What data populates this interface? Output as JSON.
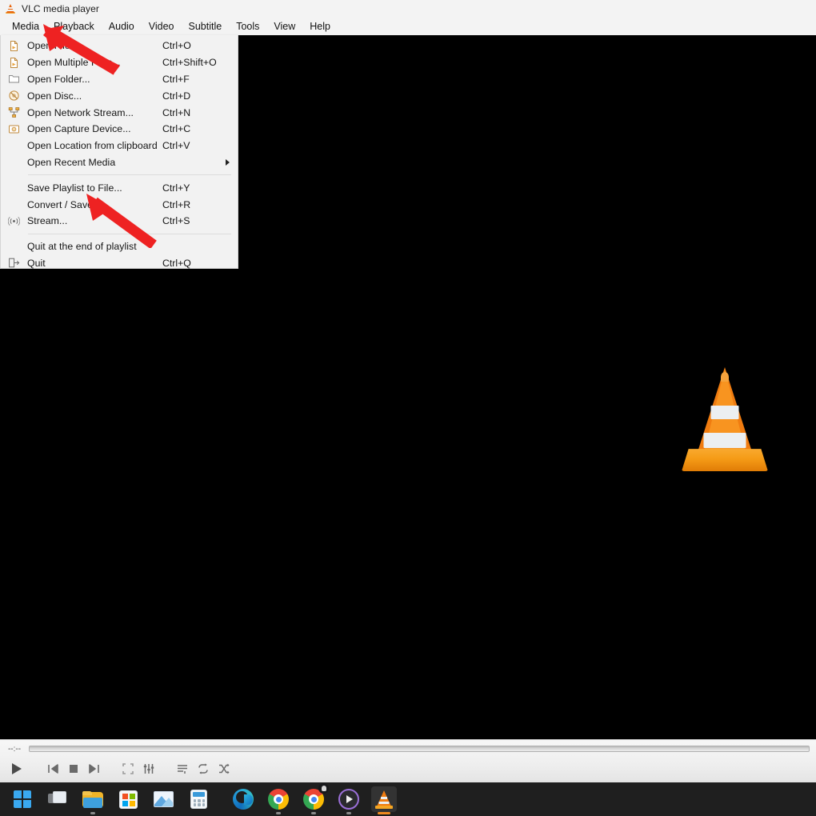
{
  "window": {
    "title": "VLC media player",
    "app_icon": "vlc-cone-icon"
  },
  "menubar": {
    "items": [
      {
        "label": "Media",
        "name": "menu-media"
      },
      {
        "label": "Playback",
        "name": "menu-playback"
      },
      {
        "label": "Audio",
        "name": "menu-audio"
      },
      {
        "label": "Video",
        "name": "menu-video"
      },
      {
        "label": "Subtitle",
        "name": "menu-subtitle"
      },
      {
        "label": "Tools",
        "name": "menu-tools"
      },
      {
        "label": "View",
        "name": "menu-view"
      },
      {
        "label": "Help",
        "name": "menu-help"
      }
    ]
  },
  "media_menu": {
    "open_label": "Media",
    "items": [
      {
        "label": "Open File...",
        "accel": "Ctrl+O",
        "icon": "file-icon",
        "submenu": false
      },
      {
        "label": "Open Multiple Files...",
        "accel": "Ctrl+Shift+O",
        "icon": "file-icon",
        "submenu": false
      },
      {
        "label": "Open Folder...",
        "accel": "Ctrl+F",
        "icon": "folder-icon",
        "submenu": false
      },
      {
        "label": "Open Disc...",
        "accel": "Ctrl+D",
        "icon": "disc-icon",
        "submenu": false
      },
      {
        "label": "Open Network Stream...",
        "accel": "Ctrl+N",
        "icon": "network-icon",
        "submenu": false
      },
      {
        "label": "Open Capture Device...",
        "accel": "Ctrl+C",
        "icon": "capture-device-icon",
        "submenu": false
      },
      {
        "label": "Open Location from clipboard",
        "accel": "Ctrl+V",
        "icon": "none",
        "submenu": false
      },
      {
        "label": "Open Recent Media",
        "accel": "",
        "icon": "none",
        "submenu": true
      },
      {
        "label": "Save Playlist to File...",
        "accel": "Ctrl+Y",
        "icon": "none",
        "submenu": false
      },
      {
        "label": "Convert / Save...",
        "accel": "Ctrl+R",
        "icon": "none",
        "submenu": false
      },
      {
        "label": "Stream...",
        "accel": "Ctrl+S",
        "icon": "broadcast-icon",
        "submenu": false
      },
      {
        "label": "Quit at the end of playlist",
        "accel": "",
        "icon": "none",
        "submenu": false
      },
      {
        "label": "Quit",
        "accel": "Ctrl+Q",
        "icon": "exit-icon",
        "submenu": false
      }
    ],
    "separator_after_indices": [
      7,
      10
    ]
  },
  "player": {
    "time_elapsed": "--:--",
    "seek_position_percent": 0,
    "controls": [
      {
        "name": "play-button",
        "icon": "play-icon"
      },
      {
        "name": "previous-button",
        "icon": "previous-icon"
      },
      {
        "name": "stop-button",
        "icon": "stop-icon"
      },
      {
        "name": "next-button",
        "icon": "next-icon"
      },
      {
        "name": "fullscreen-button",
        "icon": "fullscreen-icon"
      },
      {
        "name": "equalizer-button",
        "icon": "equalizer-icon"
      },
      {
        "name": "playlist-button",
        "icon": "playlist-icon"
      },
      {
        "name": "loop-button",
        "icon": "loop-icon"
      },
      {
        "name": "shuffle-button",
        "icon": "shuffle-icon"
      }
    ]
  },
  "taskbar": {
    "items": [
      {
        "name": "start-button",
        "icon": "windows-logo-icon",
        "state": "idle"
      },
      {
        "name": "task-view-button",
        "icon": "task-view-icon",
        "state": "idle"
      },
      {
        "name": "file-explorer-button",
        "icon": "folder-icon",
        "state": "running"
      },
      {
        "name": "microsoft-store-button",
        "icon": "store-icon",
        "state": "idle"
      },
      {
        "name": "photos-button",
        "icon": "photos-icon",
        "state": "idle"
      },
      {
        "name": "calculator-button",
        "icon": "calculator-icon",
        "state": "idle"
      },
      {
        "name": "edge-button",
        "icon": "edge-icon",
        "state": "idle"
      },
      {
        "name": "chrome-button",
        "icon": "chrome-icon",
        "state": "running"
      },
      {
        "name": "chrome-secondary-button",
        "icon": "chrome-icon",
        "state": "running"
      },
      {
        "name": "media-player-button",
        "icon": "media-player-icon",
        "state": "running"
      },
      {
        "name": "vlc-button",
        "icon": "vlc-cone-icon",
        "state": "active"
      }
    ]
  },
  "annotations": {
    "arrow_color": "#ee2222",
    "arrows": [
      {
        "name": "arrow-to-media-menu",
        "points_at": "Media / Open File..."
      },
      {
        "name": "arrow-to-convert-save",
        "points_at": "Convert / Save..."
      }
    ]
  },
  "colors": {
    "menu_bg": "#f2f2f2",
    "titlebar_bg": "#f3f3f3",
    "video_bg": "#000000",
    "taskbar_bg": "#1f1f1f",
    "vlc_orange": "#f07c10",
    "accent_active": "#f08a1e"
  }
}
